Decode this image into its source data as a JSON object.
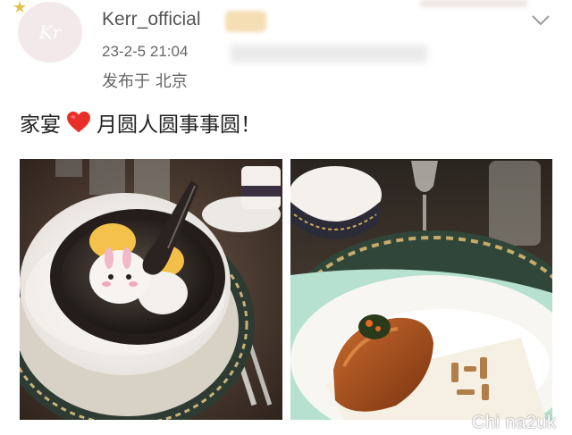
{
  "post": {
    "username": "Kerr_official",
    "avatar_text": "Kr",
    "timestamp": "23-2-5 21:04",
    "location": "发布于 北京",
    "text_before_emoji": "家宴",
    "text_after_emoji": "月圆人圆事事圆！",
    "emoji_icon": "red-heart-icon"
  },
  "watermark": {
    "text": "Chi na2uk"
  },
  "colors": {
    "heart": "#e8302a",
    "username": "#555555",
    "meta_text": "#666666"
  }
}
